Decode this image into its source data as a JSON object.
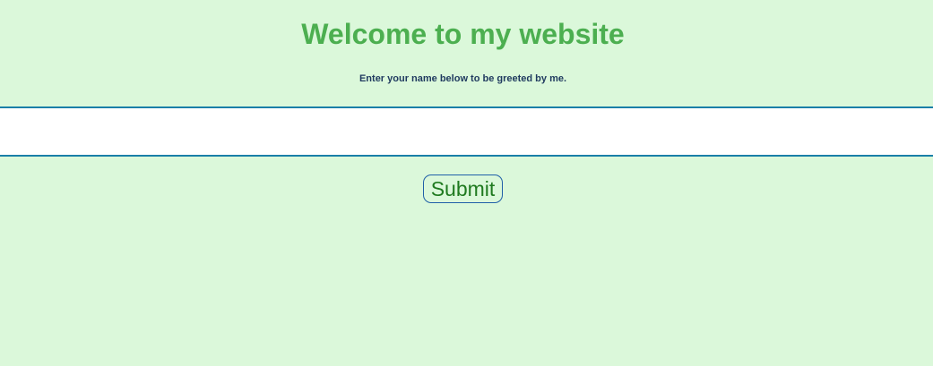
{
  "header": {
    "title": "Welcome to my website",
    "subtitle": "Enter your name below to be greeted by me."
  },
  "form": {
    "name_input_value": "",
    "name_input_placeholder": "",
    "submit_label": "Submit"
  },
  "colors": {
    "background": "#dbf8da",
    "title": "#4caf50",
    "subtitle": "#1f3a5f",
    "input_border": "#1a7fa8",
    "button_text": "#1f7a1f",
    "button_border": "#1f5fa8"
  }
}
